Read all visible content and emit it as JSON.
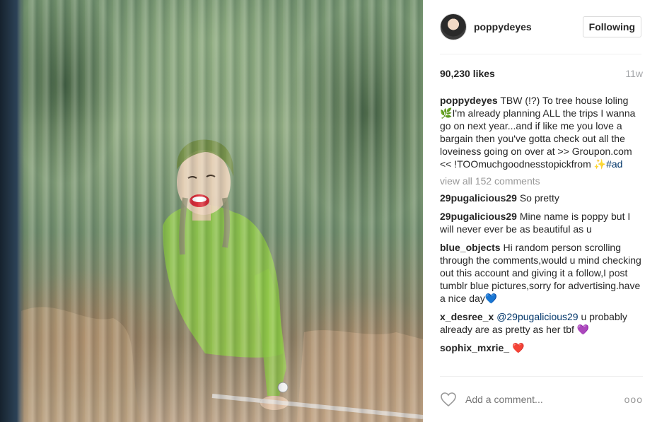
{
  "post": {
    "username": "poppydeyes",
    "follow_label": "Following",
    "likes": "90,230 likes",
    "time": "11w"
  },
  "caption": {
    "user": "poppydeyes",
    "text_1": "TBW (!?) To tree house loling ",
    "emoji_1": "🌿",
    "text_2": "I'm already planning ALL the trips I wanna go on next year...and if like me you love a bargain then you've gotta check out all the loveiness going on over at >> Groupon.com << !TOOmuchgoodnesstopickfrom ",
    "emoji_2": "✨",
    "hashtag": "#ad"
  },
  "view_all": "view all 152 comments",
  "comments": [
    {
      "user": "29pugalicious29",
      "text": "So pretty"
    },
    {
      "user": "29pugalicious29",
      "text": "Mine name is poppy but I will never ever be as beautiful as u"
    },
    {
      "user": "blue_objects",
      "text": "Hi random person scrolling through the comments,would u mind checking out this account and giving it a follow,I post tumblr blue pictures,sorry for advertising.have a nice day",
      "emoji": "💙"
    },
    {
      "user": "x_desree_x",
      "mention": "@29pugalicious29",
      "text": " u probably already are as pretty as her tbf ",
      "emoji": "💜"
    },
    {
      "user": "sophix_mxrie_",
      "text": " ",
      "emoji": "❤️"
    }
  ],
  "footer": {
    "add_comment_placeholder": "Add a comment...",
    "more_label": "ooo"
  },
  "icons": {
    "heart": "heart-icon",
    "more": "more-options-icon"
  }
}
